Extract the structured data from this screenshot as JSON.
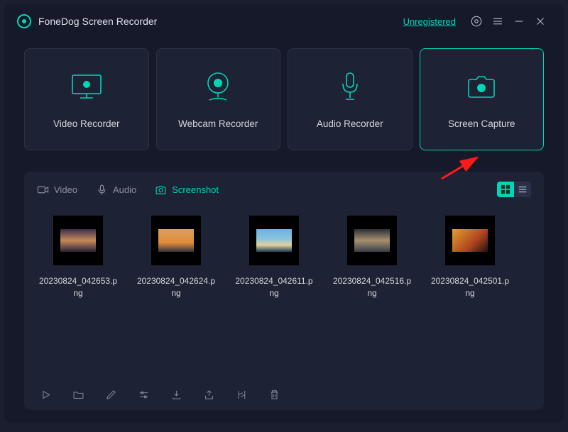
{
  "app": {
    "title": "FoneDog Screen Recorder",
    "status": "Unregistered"
  },
  "modes": [
    {
      "label": "Video Recorder",
      "active": false
    },
    {
      "label": "Webcam Recorder",
      "active": false
    },
    {
      "label": "Audio Recorder",
      "active": false
    },
    {
      "label": "Screen Capture",
      "active": true
    }
  ],
  "library": {
    "tabs": [
      {
        "label": "Video",
        "active": false
      },
      {
        "label": "Audio",
        "active": false
      },
      {
        "label": "Screenshot",
        "active": true
      }
    ],
    "view": "grid",
    "items": [
      {
        "name": "20230824_042653.png"
      },
      {
        "name": "20230824_042624.png"
      },
      {
        "name": "20230824_042611.png"
      },
      {
        "name": "20230824_042516.png"
      },
      {
        "name": "20230824_042501.png"
      }
    ]
  },
  "colors": {
    "accent": "#00d6b8",
    "panel": "#1d2234",
    "bg": "#15192a"
  }
}
